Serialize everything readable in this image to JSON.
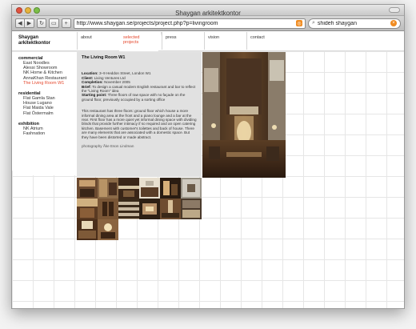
{
  "window": {
    "title": "Shaygan arkitektkontor"
  },
  "toolbar": {
    "back": "◀",
    "forward": "▶",
    "reload": "↻",
    "bookmark": "▭",
    "add": "+",
    "url": "http://www.shaygan.se/projects/project.php?p=livingroom",
    "rss": "◎",
    "search_value": "shideh shaygan",
    "search_glyph": "⌕",
    "clear": "×"
  },
  "site": {
    "brand_line1": "Shaygan",
    "brand_line2": "arkitektkontor",
    "nav": [
      {
        "label": "about"
      },
      {
        "label": "selected projects"
      },
      {
        "label": "press"
      },
      {
        "label": "vision"
      },
      {
        "label": "contact"
      }
    ]
  },
  "sidebar": {
    "sections": [
      {
        "heading": "commercial",
        "items": [
          "East Noodles",
          "Alessi Showroom",
          "NK Home & Kitchen",
          "AnnaKhan Restaurant",
          "The Living Room W1"
        ],
        "active": "The Living Room W1"
      },
      {
        "heading": "residential",
        "items": [
          "Flat Gamla Stan",
          "House Lugano",
          "Flat Maida Vale",
          "Flat Östermalm"
        ]
      },
      {
        "heading": "exhibition",
        "items": [
          "NK Atrium",
          "Fashnation"
        ]
      }
    ]
  },
  "project": {
    "title": "The Living Room W1",
    "location_label": "Location:",
    "location": "3–9 Heddon Street, London W1",
    "client_label": "Client:",
    "client": "Living Ventures Ltd",
    "completion_label": "Completion:",
    "completion": "November 2005",
    "brief_label": "Brief:",
    "brief": "To design a casual modern English restaurant and bar to reflect the \"Living Room\" idea",
    "starting_label": "Starting point:",
    "starting": "Three floors of raw space with no façade on the ground floor, previously occupied by a sorting office",
    "description": "This restaurant has three floors: ground floor which house a more informal dining area at the front and a piano lounge and a bar at the rear. First floor has a more quiet yet informal dining space with dividing blinds that provide further intimacy if so required and an open catering kitchen. Basement with customer's toilettes and back of house. There are many elements that are associated with a domestic space. But they have been distorted or made abstract.",
    "photo_credit": "photography Åke Eson Lindman"
  },
  "colors": {
    "accent": "#e4472c",
    "panel": "#e1e1e1"
  },
  "icons": [
    "back-icon",
    "forward-icon",
    "reload-icon",
    "bookmark-icon",
    "add-icon",
    "rss-icon",
    "search-icon",
    "clear-icon"
  ]
}
